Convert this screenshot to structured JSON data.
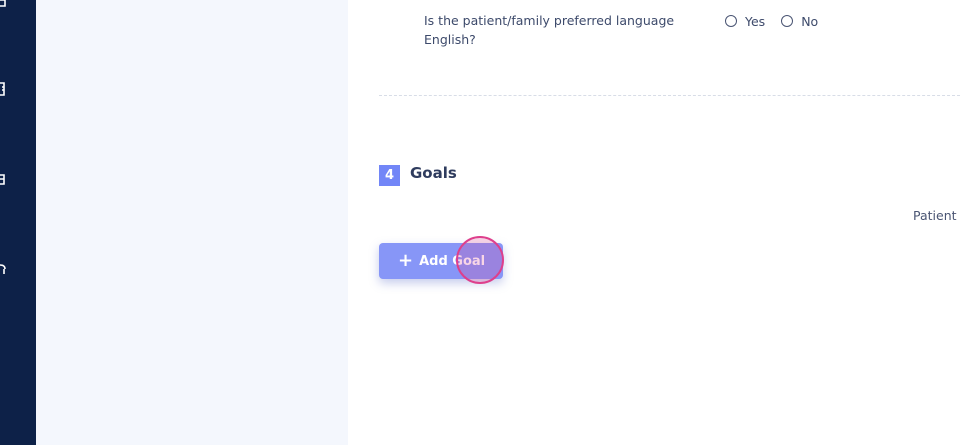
{
  "question": {
    "text": "Is the patient/family preferred language English?",
    "options": [
      {
        "label": "Yes"
      },
      {
        "label": "No"
      }
    ]
  },
  "goals_section": {
    "number": "4",
    "title": "Goals",
    "column_label": "Patient",
    "add_button_label": "Add Goal"
  },
  "sidebar": {
    "icons": [
      "calendar-icon",
      "document-icon",
      "folder-icon",
      "user-icon"
    ]
  },
  "colors": {
    "sidebar": "#0d2148",
    "accent": "#7286f7",
    "button": "#8796f7",
    "click_indicator": "#de3f8c"
  }
}
